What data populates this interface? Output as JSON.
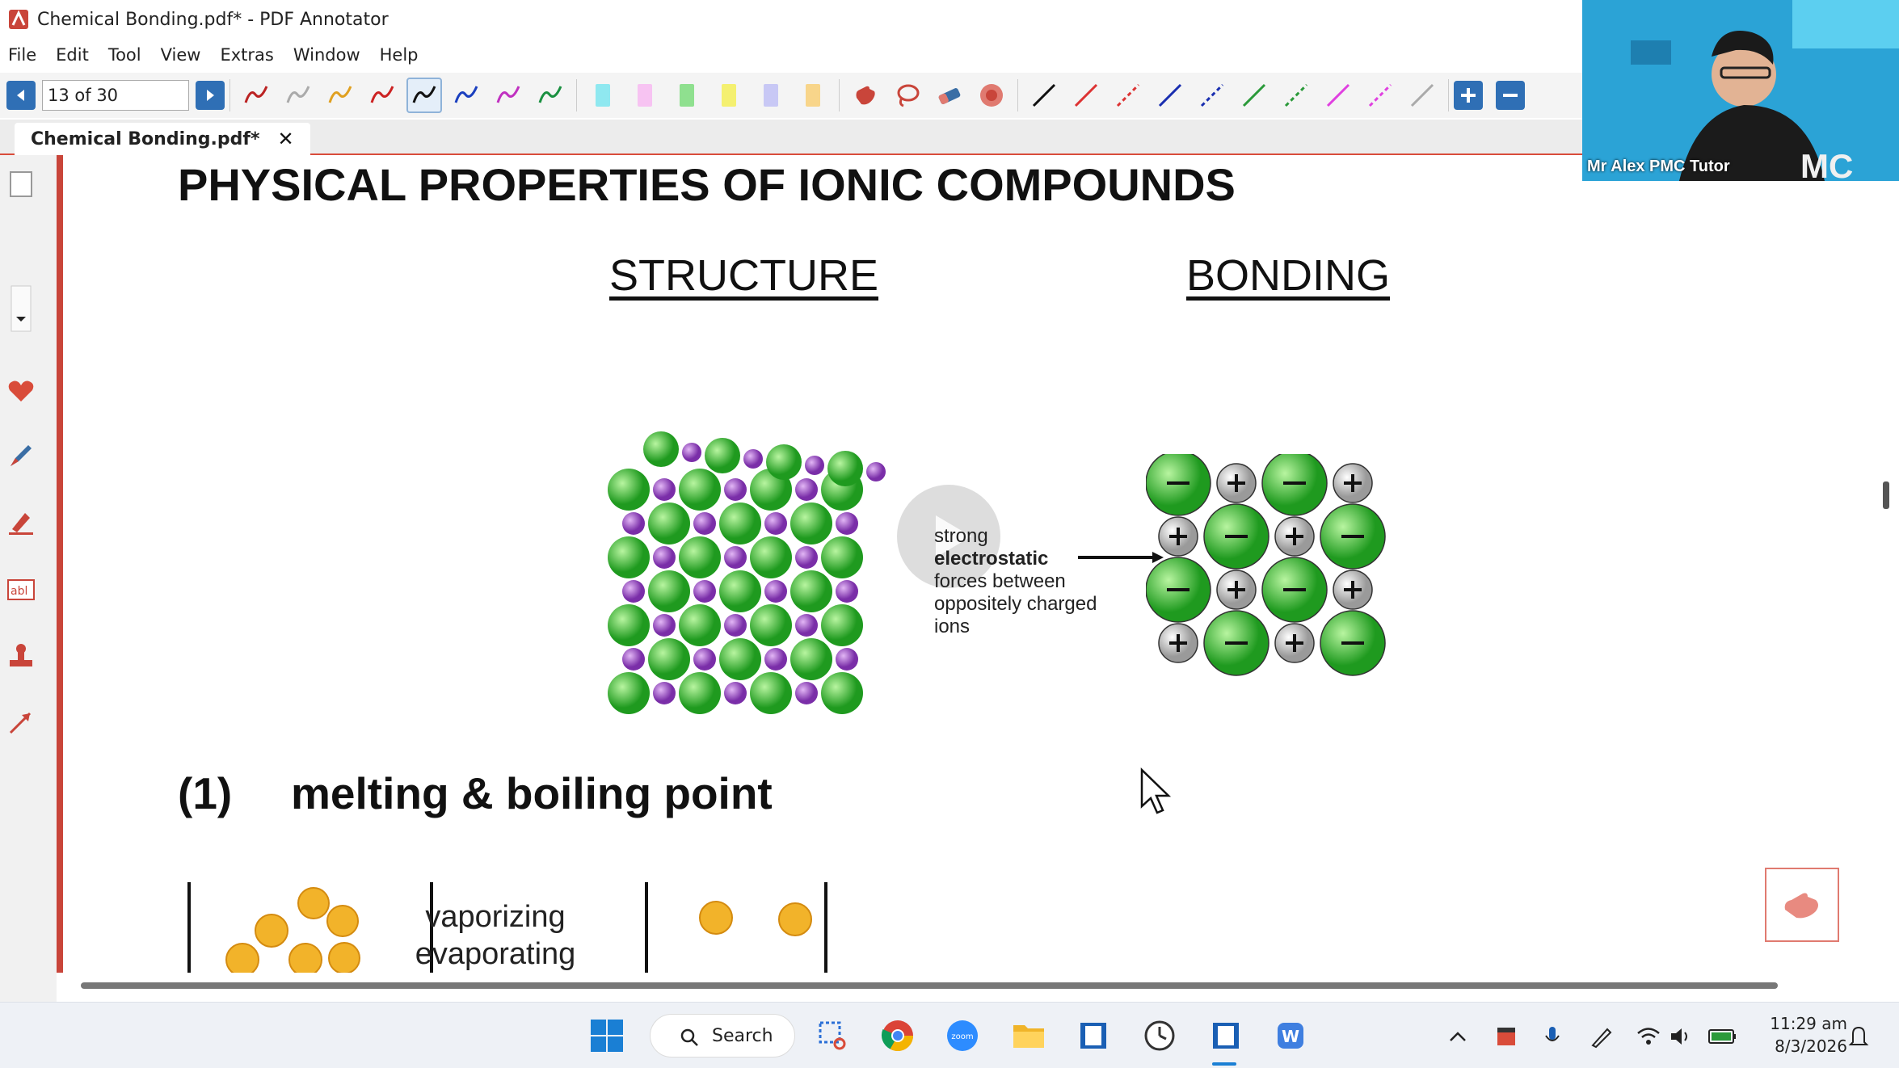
{
  "window": {
    "title": "Chemical Bonding.pdf* - PDF Annotator"
  },
  "menu": [
    "File",
    "Edit",
    "Tool",
    "View",
    "Extras",
    "Window",
    "Help"
  ],
  "toolbar": {
    "page_indicator": "13 of 30",
    "pen_colors": [
      "#b22",
      "#aaa",
      "#e0a020",
      "#c22",
      "#111",
      "#1a3fbf",
      "#c030c0",
      "#1a9040"
    ],
    "marker_colors": [
      "#8fe8f0",
      "#f7c3f2",
      "#8fe08f",
      "#f4f070",
      "#c8c8f5",
      "#f8d58a"
    ],
    "line_colors": [
      "#111",
      "#d33",
      "#d33",
      "#1a2fb0",
      "#1a2fb0",
      "#2b9a3a",
      "#2b9a3a",
      "#e040e0",
      "#e040e0",
      "#aaa"
    ]
  },
  "tab": {
    "label": "Chemical Bonding.pdf*",
    "close": "✕"
  },
  "page": {
    "title": "PHYSICAL PROPERTIES OF IONIC COMPOUNDS",
    "structure_heading": "STRUCTURE",
    "bonding_heading": "BONDING",
    "annotation_lines": [
      "strong",
      "electrostatic",
      "forces between",
      "oppositely charged",
      "ions"
    ],
    "section_number": "(1)",
    "section_title": "melting & boiling point",
    "vaporizing_line1": "vaporizing",
    "vaporizing_line2": "evaporating"
  },
  "webcam": {
    "label": "Mr Alex PMC Tutor"
  },
  "taskbar": {
    "search_label": "Search",
    "time": "11:29 am",
    "date": "8/3/2026"
  }
}
